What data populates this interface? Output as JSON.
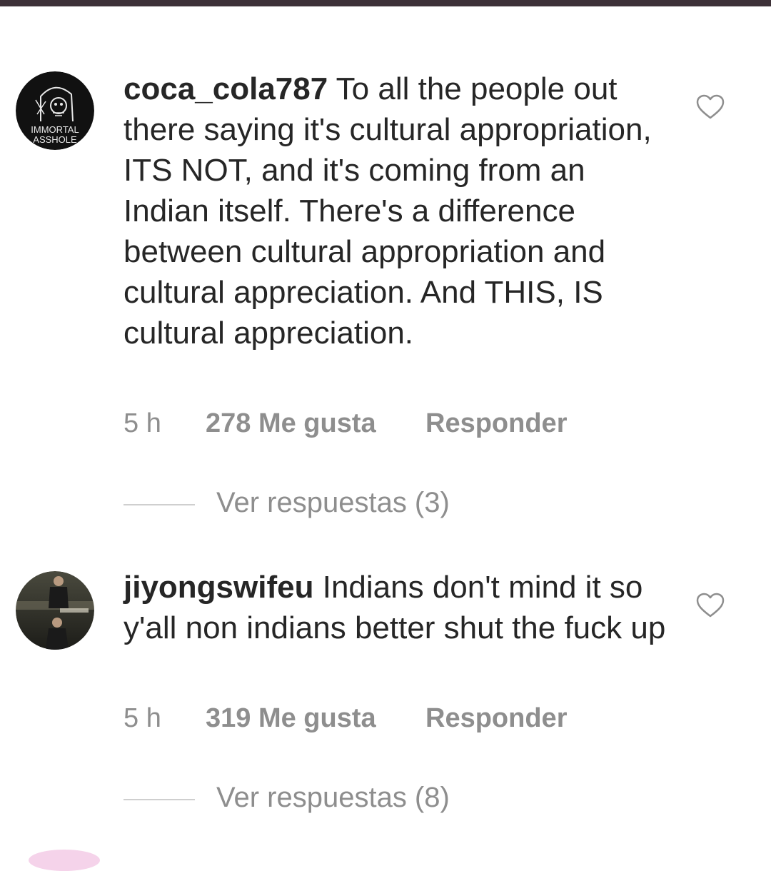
{
  "colors": {
    "top_bar": "#3d3138",
    "text": "#262626",
    "muted": "#8e8e8e"
  },
  "comments": [
    {
      "username": "coca_cola787",
      "text": "To all the people out there saying it's cultural appropriation,  ITS NOT, and it's coming from an Indian itself. There's a difference between cultural appropriation and cultural appreciation.  And THIS, IS cultural appreciation.",
      "avatar_text_1": "IMMORTAL",
      "avatar_text_2": "ASSHOLE",
      "time": "5 h",
      "likes": "278 Me gusta",
      "reply": "Responder",
      "view_replies": "Ver respuestas (3)",
      "like_icon": "heart-outline-icon"
    },
    {
      "username": "jiyongswifeu",
      "text": "Indians don't mind it so y'all non indians better shut the fuck up",
      "time": "5 h",
      "likes": "319 Me gusta",
      "reply": "Responder",
      "view_replies": "Ver respuestas (8)",
      "like_icon": "heart-outline-icon"
    }
  ]
}
